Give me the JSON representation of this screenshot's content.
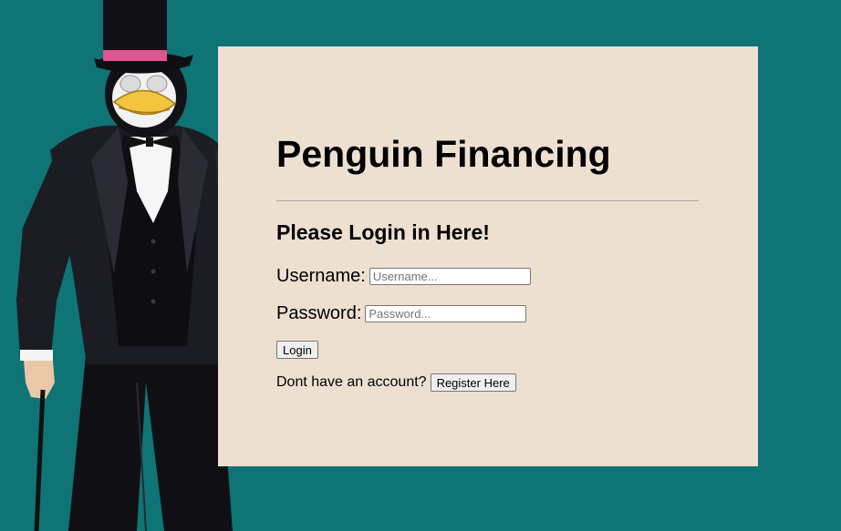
{
  "title": "Penguin Financing",
  "subtitle": "Please Login in Here!",
  "username": {
    "label": "Username:",
    "placeholder": "Username...",
    "value": ""
  },
  "password": {
    "label": "Password:",
    "placeholder": "Password...",
    "value": ""
  },
  "login_button": "Login",
  "register": {
    "prompt": "Dont have an account?",
    "button": "Register Here"
  },
  "colors": {
    "background": "#0e7475",
    "card": "#ede0d1",
    "hat_band": "#e0558f",
    "beak": "#f3c43f"
  },
  "illustration": "penguin-in-top-hat-and-suit"
}
